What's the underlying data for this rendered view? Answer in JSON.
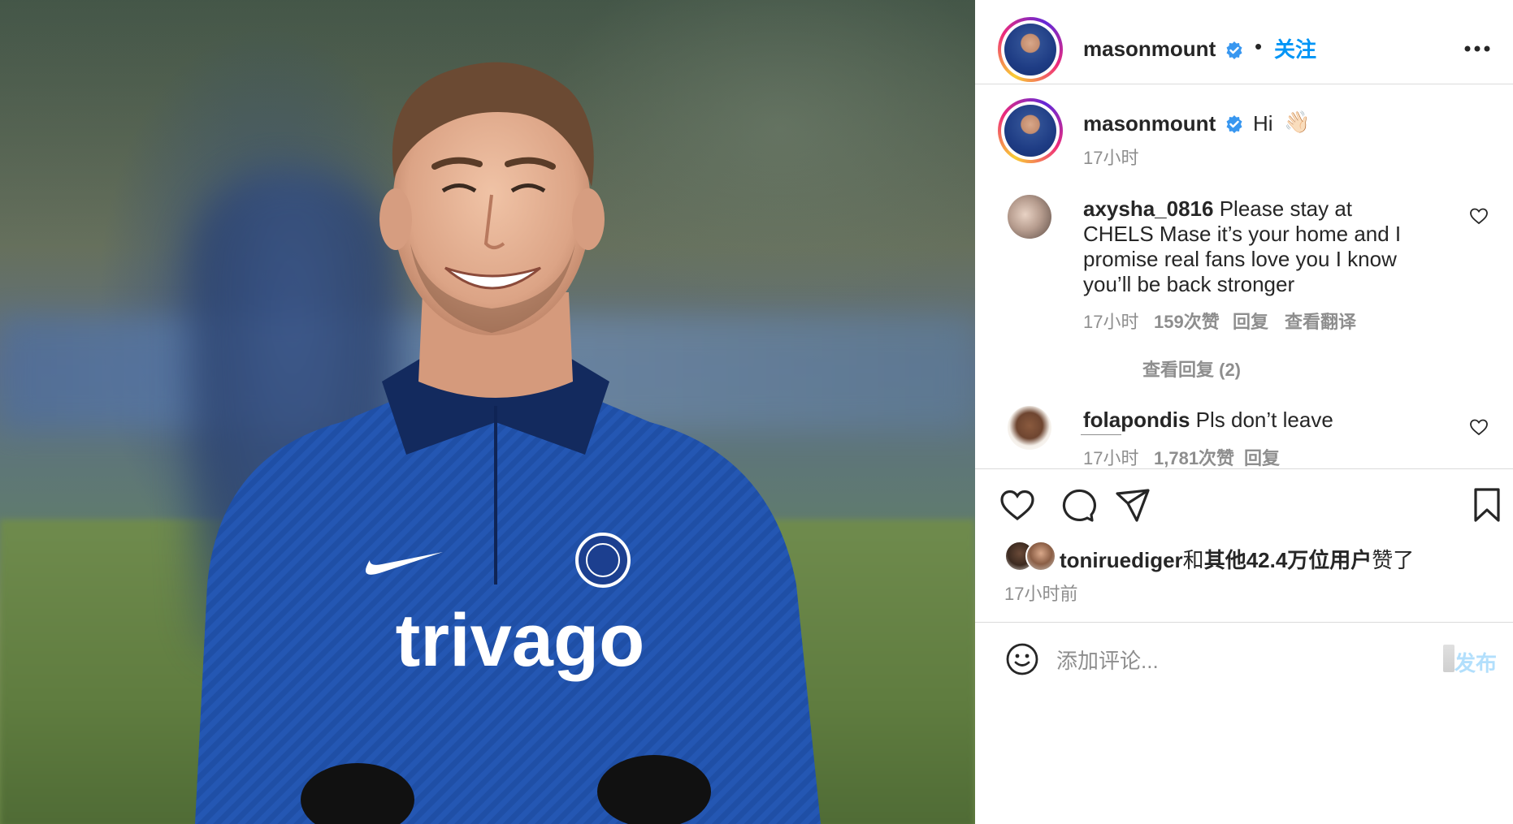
{
  "post": {
    "image_alt": "Mason Mount smiling in blue Chelsea training top with trivago sponsor",
    "shirt_sponsor": "trivago",
    "crest_text": "CHELSEA"
  },
  "header": {
    "username": "masonmount",
    "separator": "•",
    "follow_label": "关注"
  },
  "caption": {
    "username": "masonmount",
    "text": "Hi",
    "emoji": "👋🏻",
    "time": "17小时"
  },
  "comments": [
    {
      "username": "axysha_0816",
      "text": "Please stay at CHELS Mase it’s your home and I promise real fans love you I know you’ll be back stronger",
      "time": "17小时",
      "likes": "159次赞",
      "reply": "回复",
      "translate": "查看翻译",
      "view_replies": "查看回复 (2)"
    },
    {
      "username": "folapondis",
      "text": "Pls don’t leave",
      "time": "17小时",
      "likes": "1,781次赞",
      "reply": "回复"
    }
  ],
  "likes": {
    "user": "toniruediger",
    "joiner": "和",
    "others": "其他42.4万位用户",
    "suffix": "赞了"
  },
  "post_time": "17小时前",
  "add_comment": {
    "placeholder": "添加评论...",
    "post_label": "发布"
  },
  "colors": {
    "accent": "#0095f6",
    "post_disabled": "#b2dffc",
    "secondary_text": "#8e8e8e",
    "verified": "#3897f0"
  }
}
